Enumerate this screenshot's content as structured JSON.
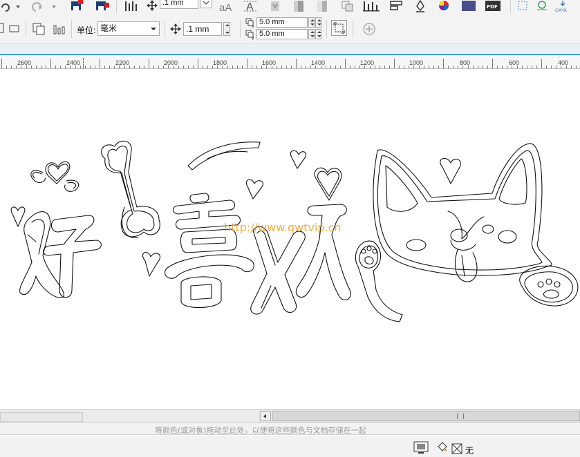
{
  "toolbar": {
    "nudge_value": ".1 mm",
    "icons": [
      "undo-icon",
      "redo-icon",
      "import-icon",
      "export-icon",
      "align-icon",
      "nudge-icon",
      "text-aA-icon",
      "text-A-icon",
      "transparency-icon",
      "gradient-icon",
      "copy-properties-icon",
      "distribute-icon",
      "order-icon",
      "pen-icon",
      "color-wheel-icon",
      "fill-swatch-icon",
      "pdf-icon",
      "cmyk-icon"
    ]
  },
  "property_bar": {
    "units_label": "单位:",
    "units_value": "毫米",
    "nudge_value": ".1 mm",
    "dup_x_value": "5.0 mm",
    "dup_y_value": "5.0 mm"
  },
  "ruler": {
    "ticks": [
      "2600",
      "2400",
      "2200",
      "2000",
      "1800",
      "1600",
      "1400",
      "1200",
      "1000",
      "800",
      "600",
      "400"
    ]
  },
  "canvas": {
    "watermark": "http://www.qwtvip.cn"
  },
  "palette_hint": "将颜色(或对象)拖动至此处，以便将这些颜色与文档存储在一起",
  "status": {
    "fill_none_label": "无"
  },
  "colors": {
    "accent_line": "#37a0d6",
    "watermark": "#f0a020",
    "outline": "#111111"
  }
}
